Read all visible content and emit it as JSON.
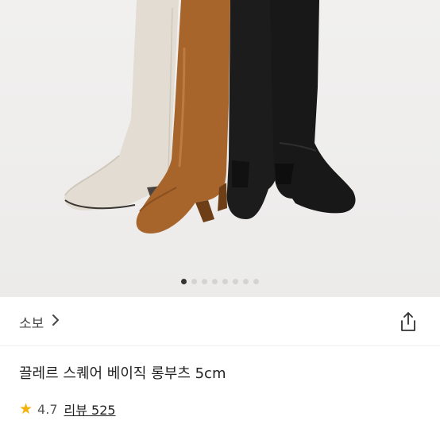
{
  "product": {
    "image_alt": "Boots product image",
    "carousel": {
      "count": 8,
      "active": 0
    },
    "store_name": "소보",
    "title": "끌레르 스퀘어 베이직 롱부츠 5cm",
    "rating": "4.7",
    "review_label": "리뷰 525",
    "icons": {
      "chevron": "chevron-right-icon",
      "share": "share-icon",
      "star": "star-icon"
    }
  },
  "colors": {
    "star": "#f5b20a",
    "active_dot": "#333333",
    "dot": "#d3d3d3"
  }
}
